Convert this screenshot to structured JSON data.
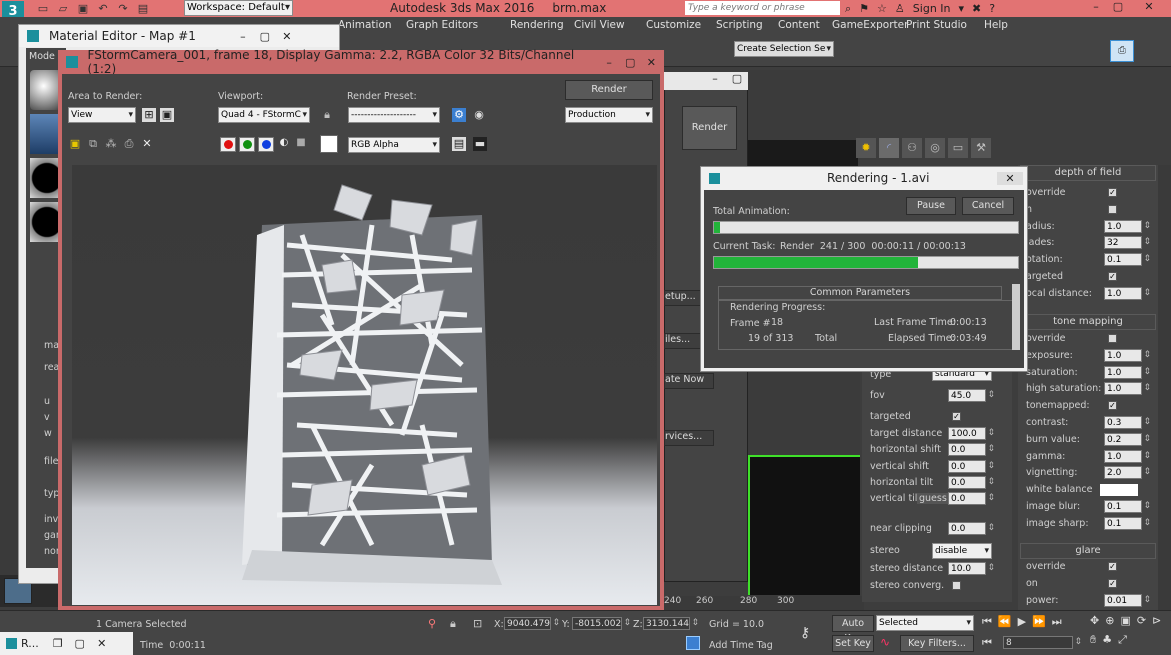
{
  "app": {
    "title": "Autodesk 3ds Max 2016",
    "file": "brm.max",
    "workspace": "Workspace: Default",
    "search_placeholder": "Type a keyword or phrase",
    "sign_in": "Sign In"
  },
  "menu": [
    "Animation",
    "Graph Editors",
    "Rendering",
    "Civil View",
    "Customize",
    "Scripting",
    "Content",
    "GameExporter",
    "Print Studio",
    "Help"
  ],
  "toolbar": {
    "selection_set": "Create Selection Se"
  },
  "material_editor": {
    "title": "Material Editor - Map #1",
    "mode": "Mode",
    "labels": [
      "map",
      "rea",
      "u",
      "v",
      "w",
      "file",
      "typ",
      "inv",
      "gar",
      "nor"
    ]
  },
  "frame_window": {
    "title": "FStormCamera_001, frame 18, Display Gamma: 2.2, RGBA Color 32 Bits/Channel (1:2)",
    "area_label": "Area to Render:",
    "area_value": "View",
    "viewport_label": "Viewport:",
    "viewport_value": "Quad 4 - FStormC",
    "preset_label": "Render Preset:",
    "preset_value": "--------------------",
    "render_btn": "Render",
    "production": "Production",
    "channel": "RGB Alpha"
  },
  "render_setup": {
    "render_btn": "Render",
    "items": [
      "etup...",
      "iles...",
      "ate Now",
      "rvices..."
    ]
  },
  "rendering_dialog": {
    "title": "Rendering - 1.avi",
    "total_animation": "Total Animation:",
    "total_progress": 0.02,
    "pause": "Pause",
    "cancel": "Cancel",
    "current_task_label": "Current Task:",
    "current_task": "Render  241 / 300  00:00:11 / 00:00:13",
    "task_progress": 0.67,
    "common_params": "Common Parameters",
    "rendering_progress": "Rendering Progress:",
    "frame_label": "Frame #",
    "frame_value": "18",
    "of_frames": "19 of 313",
    "total": "Total",
    "last_frame_label": "Last Frame Time:",
    "last_frame_time": "0:00:13",
    "elapsed_label": "Elapsed Time:",
    "elapsed_time": "0:03:49"
  },
  "camera_panel": {
    "type_label": "type",
    "type_value": "standard",
    "rows": [
      {
        "label": "fov",
        "value": "45.0"
      },
      {
        "label": "targeted",
        "check": true
      },
      {
        "label": "target distance",
        "value": "100.0"
      },
      {
        "label": "horizontal shift",
        "value": "0.0"
      },
      {
        "label": "vertical shift",
        "value": "0.0"
      },
      {
        "label": "horizontal tilt",
        "value": "0.0"
      },
      {
        "label": "vertical tilt",
        "extra": "guess",
        "value": "0.0"
      },
      {
        "label": "near clipping",
        "value": "0.0"
      },
      {
        "label": "stereo",
        "select": "disable"
      },
      {
        "label": "stereo distance",
        "value": "10.0"
      },
      {
        "label": "stereo converg.",
        "check": false
      }
    ]
  },
  "dof_panel": {
    "title": "depth of field",
    "rows": [
      {
        "label": "override",
        "check": true
      },
      {
        "label": "n",
        "check": false
      },
      {
        "label": "adius:",
        "value": "1.0"
      },
      {
        "label": "lades:",
        "value": "32"
      },
      {
        "label": "otation:",
        "value": "0.1"
      },
      {
        "label": "argeted",
        "check": true
      },
      {
        "label": "ocal distance:",
        "value": "1.0"
      }
    ]
  },
  "tone_panel": {
    "title": "tone mapping",
    "rows": [
      {
        "label": "override",
        "check": false
      },
      {
        "label": "exposure:",
        "value": "1.0"
      },
      {
        "label": "saturation:",
        "value": "1.0"
      },
      {
        "label": "high saturation:",
        "value": "1.0"
      },
      {
        "label": "tonemapped:",
        "check": true
      },
      {
        "label": "contrast:",
        "value": "0.3"
      },
      {
        "label": "burn value:",
        "value": "0.2"
      },
      {
        "label": "gamma:",
        "value": "1.0"
      },
      {
        "label": "vignetting:",
        "value": "2.0"
      },
      {
        "label": "white balance",
        "swatch": true
      },
      {
        "label": "image blur:",
        "value": "0.1"
      },
      {
        "label": "image sharp:",
        "value": "0.1"
      }
    ]
  },
  "glare_panel": {
    "title": "glare",
    "rows": [
      {
        "label": "override",
        "check": true
      },
      {
        "label": "on",
        "check": true
      },
      {
        "label": "power:",
        "value": "0.01"
      }
    ]
  },
  "ruler": [
    "240",
    "260",
    "280",
    "300"
  ],
  "status": {
    "selected": "1 Camera Selected",
    "x": "9040.479",
    "y": "-8015.002",
    "z": "3130.144",
    "grid": "Grid = 10.0",
    "time": "Time  0:00:11",
    "add_time_tag": "Add Time Tag",
    "auto_key": "Auto Key",
    "set_key": "Set Key",
    "key_mode": "Selected",
    "key_filters": "Key Filters...",
    "frame": "8",
    "taskbar": "R..."
  },
  "colors": {
    "title_red": "#e36c6c",
    "frame_border": "#c96a6a",
    "progress": "#22b43a"
  }
}
